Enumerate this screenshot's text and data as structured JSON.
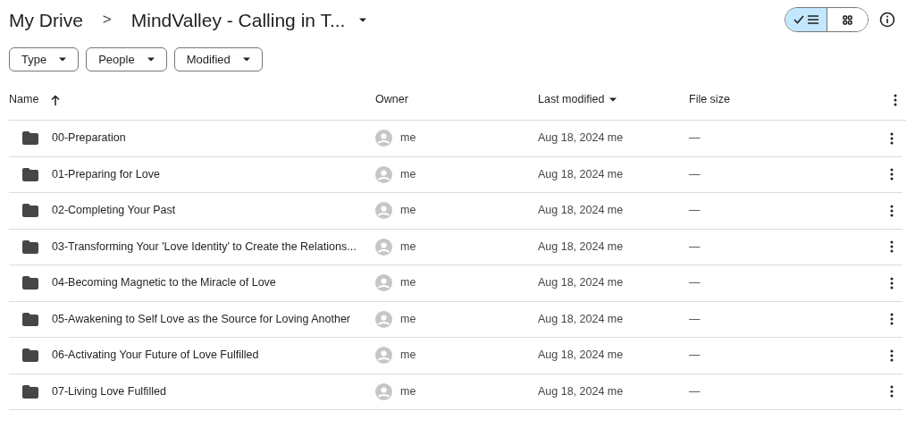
{
  "breadcrumb": {
    "root": "My Drive",
    "separator": ">",
    "current": "MindValley - Calling in T..."
  },
  "view_toggle": [
    {
      "kind": "list",
      "selected": true
    },
    {
      "kind": "grid",
      "selected": false
    }
  ],
  "filters": [
    {
      "label": "Type"
    },
    {
      "label": "People"
    },
    {
      "label": "Modified"
    }
  ],
  "table": {
    "columns": [
      {
        "label": "Name",
        "kind": "sort_asc"
      },
      {
        "label": "Owner",
        "kind": "plain"
      },
      {
        "label": "Last modified",
        "kind": "menu"
      },
      {
        "label": "File size",
        "kind": "plain"
      }
    ],
    "rows": [
      {
        "name": "00-Preparation",
        "owner": "me",
        "modified": "Aug 18, 2024 me",
        "size": "—"
      },
      {
        "name": "01-Preparing for Love",
        "owner": "me",
        "modified": "Aug 18, 2024 me",
        "size": "—"
      },
      {
        "name": "02-Completing Your Past",
        "owner": "me",
        "modified": "Aug 18, 2024 me",
        "size": "—"
      },
      {
        "name": "03-Transforming Your 'Love Identity' to Create the Relations...",
        "owner": "me",
        "modified": "Aug 18, 2024 me",
        "size": "—"
      },
      {
        "name": "04-Becoming Magnetic to the Miracle of Love",
        "owner": "me",
        "modified": "Aug 18, 2024 me",
        "size": "—"
      },
      {
        "name": "05-Awakening to Self Love as the Source for Loving Another",
        "owner": "me",
        "modified": "Aug 18, 2024 me",
        "size": "—"
      },
      {
        "name": "06-Activating Your Future of Love Fulfilled",
        "owner": "me",
        "modified": "Aug 18, 2024 me",
        "size": "—"
      },
      {
        "name": "07-Living Love Fulfilled",
        "owner": "me",
        "modified": "Aug 18, 2024 me",
        "size": "—"
      }
    ]
  }
}
